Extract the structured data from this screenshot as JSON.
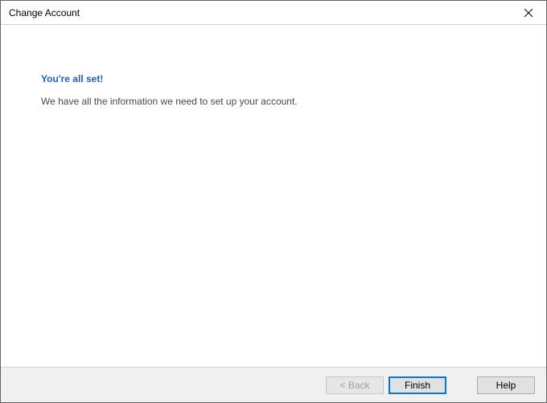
{
  "window": {
    "title": "Change Account"
  },
  "content": {
    "headline": "You're all set!",
    "subtext": "We have all the information we need to set up your account."
  },
  "footer": {
    "back_label": "< Back",
    "finish_label": "Finish",
    "help_label": "Help"
  }
}
